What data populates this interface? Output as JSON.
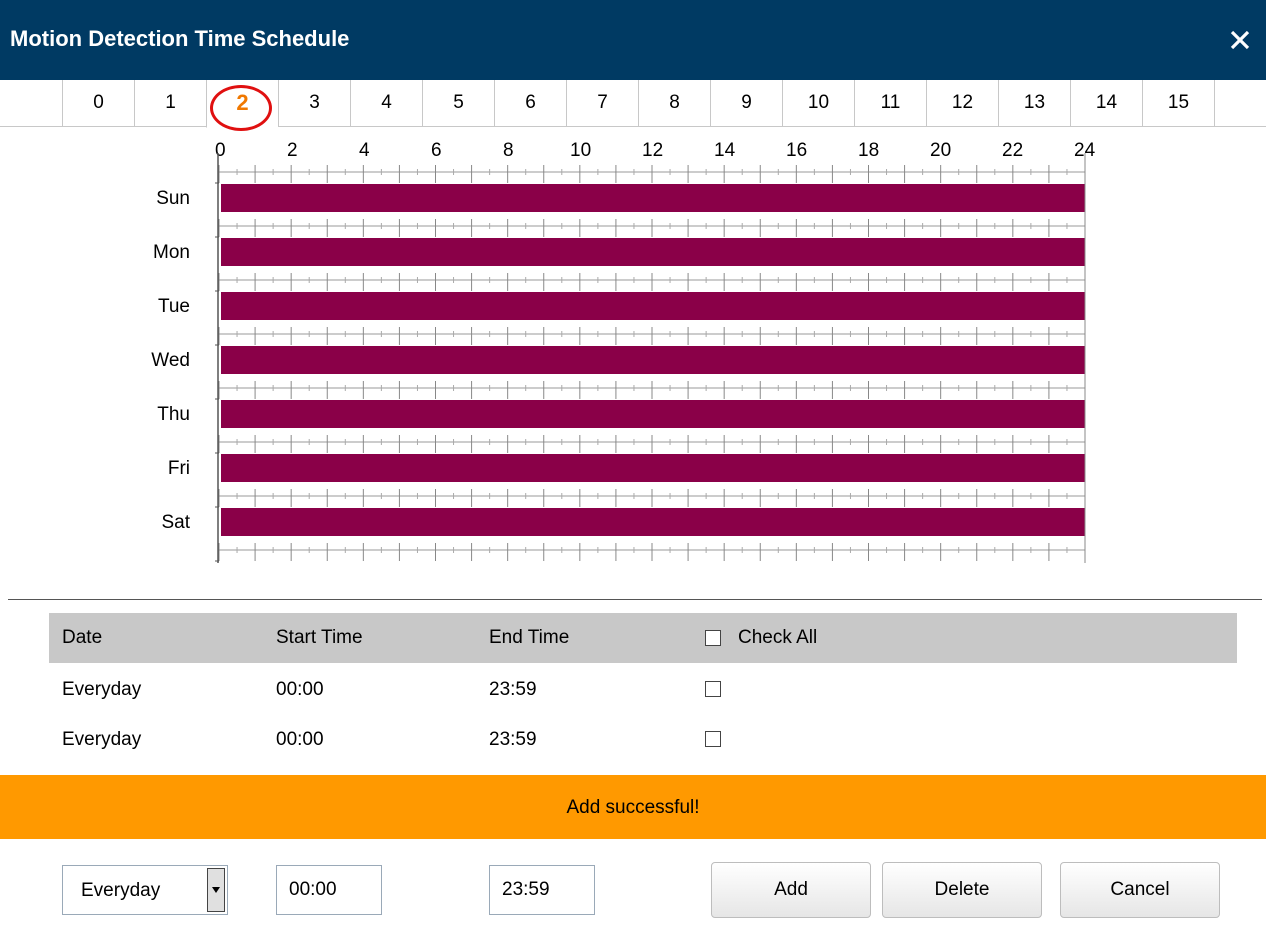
{
  "window": {
    "title": "Motion Detection Time Schedule",
    "close_icon": "close-icon"
  },
  "tabs": [
    {
      "label": "0"
    },
    {
      "label": "1"
    },
    {
      "label": "2",
      "active": true
    },
    {
      "label": "3"
    },
    {
      "label": "4"
    },
    {
      "label": "5"
    },
    {
      "label": "6"
    },
    {
      "label": "7"
    },
    {
      "label": "8"
    },
    {
      "label": "9"
    },
    {
      "label": "10"
    },
    {
      "label": "11"
    },
    {
      "label": "12"
    },
    {
      "label": "13"
    },
    {
      "label": "14"
    },
    {
      "label": "15"
    }
  ],
  "schedule": {
    "hour_labels": [
      "0",
      "2",
      "4",
      "6",
      "8",
      "10",
      "12",
      "14",
      "16",
      "18",
      "20",
      "22",
      "24"
    ],
    "days": [
      "Sun",
      "Mon",
      "Tue",
      "Wed",
      "Thu",
      "Fri",
      "Sat"
    ],
    "range_hours": [
      0,
      24
    ],
    "block_color": "#8a0048"
  },
  "table": {
    "headers": {
      "date": "Date",
      "start": "Start Time",
      "end": "End Time",
      "check_all": "Check All"
    },
    "rows": [
      {
        "date": "Everyday",
        "start": "00:00",
        "end": "23:59"
      },
      {
        "date": "Everyday",
        "start": "00:00",
        "end": "23:59"
      }
    ]
  },
  "status": {
    "message": "Add successful!",
    "color": "#ff9900"
  },
  "controls": {
    "day_select": "Everyday",
    "start_value": "00:00",
    "end_value": "23:59",
    "add_label": "Add",
    "delete_label": "Delete",
    "cancel_label": "Cancel"
  }
}
